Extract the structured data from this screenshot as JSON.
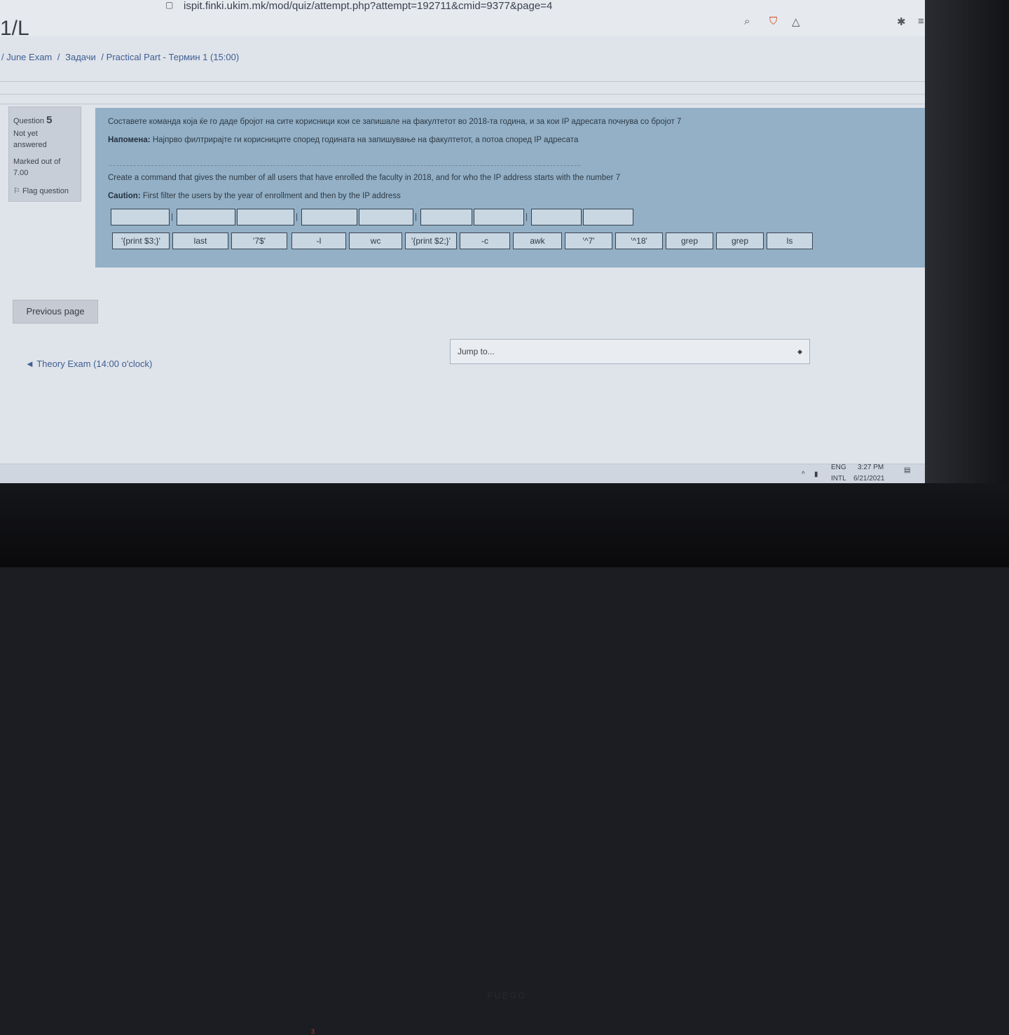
{
  "browser": {
    "url": "ispit.finki.ukim.mk/mod/quiz/attempt.php?attempt=192711&cmid=9377&page=4",
    "url_icon": "page-icon",
    "search_icon": "zoom-icon",
    "brave_icon": "brave-shield-icon",
    "rewards_icon": "triangle-icon",
    "extensions_icon": "puzzle-icon",
    "menu_icon": "menu-icon"
  },
  "site": {
    "title": "1/L"
  },
  "breadcrumb": {
    "items": [
      "/ June Exam",
      "/",
      "Задачи",
      "/ Practical Part - Термин 1 (15:00)"
    ]
  },
  "question_info": {
    "label": "Question",
    "number": "5",
    "status_line1": "Not yet",
    "status_line2": "answered",
    "marked_line1": "Marked out of",
    "marked_line2": "7.00",
    "flag_label": "Flag question",
    "flag_icon": "flag-icon"
  },
  "question": {
    "text_mk": "Составете команда која ќе го даде бројот на сите корисници кои се запишале на факултетот во 2018-та година, и за кои IP адресата почнува со бројот 7",
    "note_label_mk": "Напомена:",
    "note_mk": "Најпрво филтрирајте ги корисниците според годината на запишување на факултетот, а потоа според IP адресата",
    "text_en": "Create a command that gives the number of all users that have enrolled the faculty in 2018, and for who the IP address starts with the number 7",
    "caution_label": "Caution:",
    "caution": "First filter the users by the year of enrollment and then by the IP address",
    "separators": [
      "|",
      "|",
      "|",
      "|"
    ],
    "drag_items": [
      "'{print $3;}'",
      "last",
      "'7$'",
      "-l",
      "wc",
      "'{print $2;}'",
      "-c",
      "awk",
      "'^7'",
      "'^18'",
      "grep",
      "grep",
      "ls"
    ]
  },
  "navigation": {
    "prev_label": "Previous page",
    "jump_placeholder": "Jump to...",
    "theory_link": "◄ Theory Exam (14:00 o'clock)"
  },
  "tray": {
    "lang1": "ENG",
    "lang2": "INTL",
    "time": "3:27 PM",
    "date": "6/21/2021"
  },
  "monitor": {
    "brand": "FUEGO",
    "led": "3"
  }
}
